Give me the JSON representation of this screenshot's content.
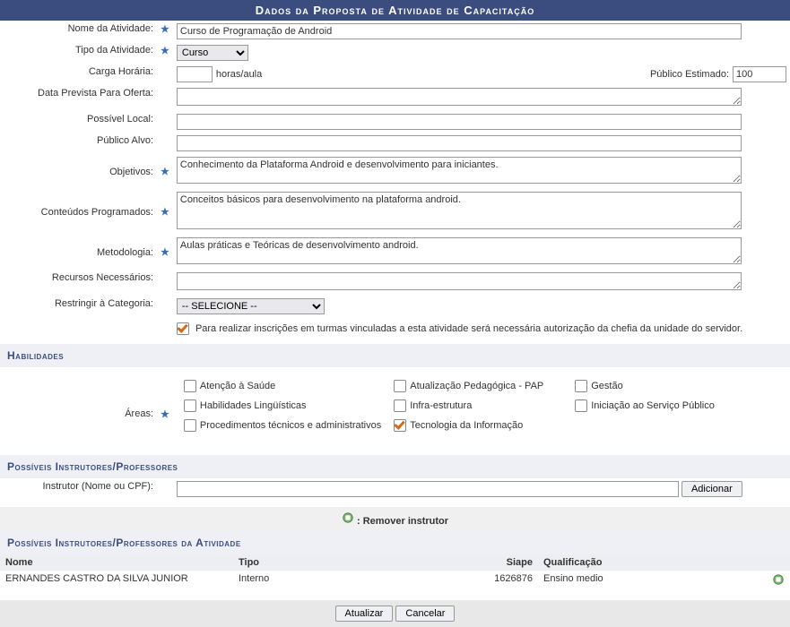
{
  "header": {
    "title": "Dados da Proposta de Atividade de Capacitação"
  },
  "form": {
    "labels": {
      "nome_atividade": "Nome da Atividade:",
      "tipo_atividade": "Tipo da Atividade:",
      "carga_horaria": "Carga Horária:",
      "horas_aula": "horas/aula",
      "publico_estimado": "Público Estimado:",
      "data_prevista": "Data Prevista Para Oferta:",
      "possivel_local": "Possível Local:",
      "publico_alvo": "Público Alvo:",
      "objetivos": "Objetivos:",
      "conteudos": "Conteúdos Programados:",
      "metodologia": "Metodologia:",
      "recursos": "Recursos Necessários:",
      "restringir": "Restringir à Categoria:",
      "areas": "Áreas:",
      "instrutor_lookup": "Instrutor (Nome ou CPF):"
    },
    "values": {
      "nome_atividade": "Curso de Programação de Android",
      "tipo_atividade": "Curso",
      "carga_horaria": "",
      "publico_estimado": "100",
      "data_prevista": "",
      "possivel_local": "",
      "publico_alvo": "",
      "objetivos": "Conhecimento da Plataforma Android e desenvolvimento para iniciantes.",
      "conteudos": "Conceitos básicos para desenvolvimento na plataforma android.",
      "metodologia": "Aulas práticas e Teóricas de desenvolvimento android.",
      "recursos": "",
      "restringir": "-- SELECIONE --",
      "instrutor_lookup": ""
    },
    "authorization_msg": "Para realizar inscrições em turmas vinculadas a esta atividade será necessária autorização da chefia da unidade do servidor.",
    "authorization_checked": true,
    "buttons": {
      "adicionar": "Adicionar",
      "atualizar": "Atualizar",
      "cancelar": "Cancelar"
    }
  },
  "sections": {
    "habilidades": "Habilidades",
    "instrutores": "Possíveis Instrutores/Professores",
    "instrutores_atividade": "Possíveis Instrutores/Professores da Atividade"
  },
  "areas": {
    "row1": [
      {
        "label": "Atenção à Saúde",
        "checked": false
      },
      {
        "label": "Atualização Pedagógica - PAP",
        "checked": false
      },
      {
        "label": "Gestão",
        "checked": false
      }
    ],
    "row2": [
      {
        "label": "Habilidades Lingüísticas",
        "checked": false
      },
      {
        "label": "Infra-estrutura",
        "checked": false
      },
      {
        "label": "Iniciação ao Serviço Público",
        "checked": false
      }
    ],
    "row3": [
      {
        "label": "Procedimentos técnicos e administrativos",
        "checked": false
      },
      {
        "label": "Tecnologia da Informação",
        "checked": true
      }
    ]
  },
  "legend": {
    "remove": ": Remover instrutor"
  },
  "instrutores_table": {
    "headers": {
      "nome": "Nome",
      "tipo": "Tipo",
      "siape": "Siape",
      "qualificacao": "Qualificação"
    },
    "row": {
      "nome": "ERNANDES CASTRO DA SILVA JUNIOR",
      "tipo": "Interno",
      "siape": "1626876",
      "qualificacao": "Ensino medio"
    }
  }
}
